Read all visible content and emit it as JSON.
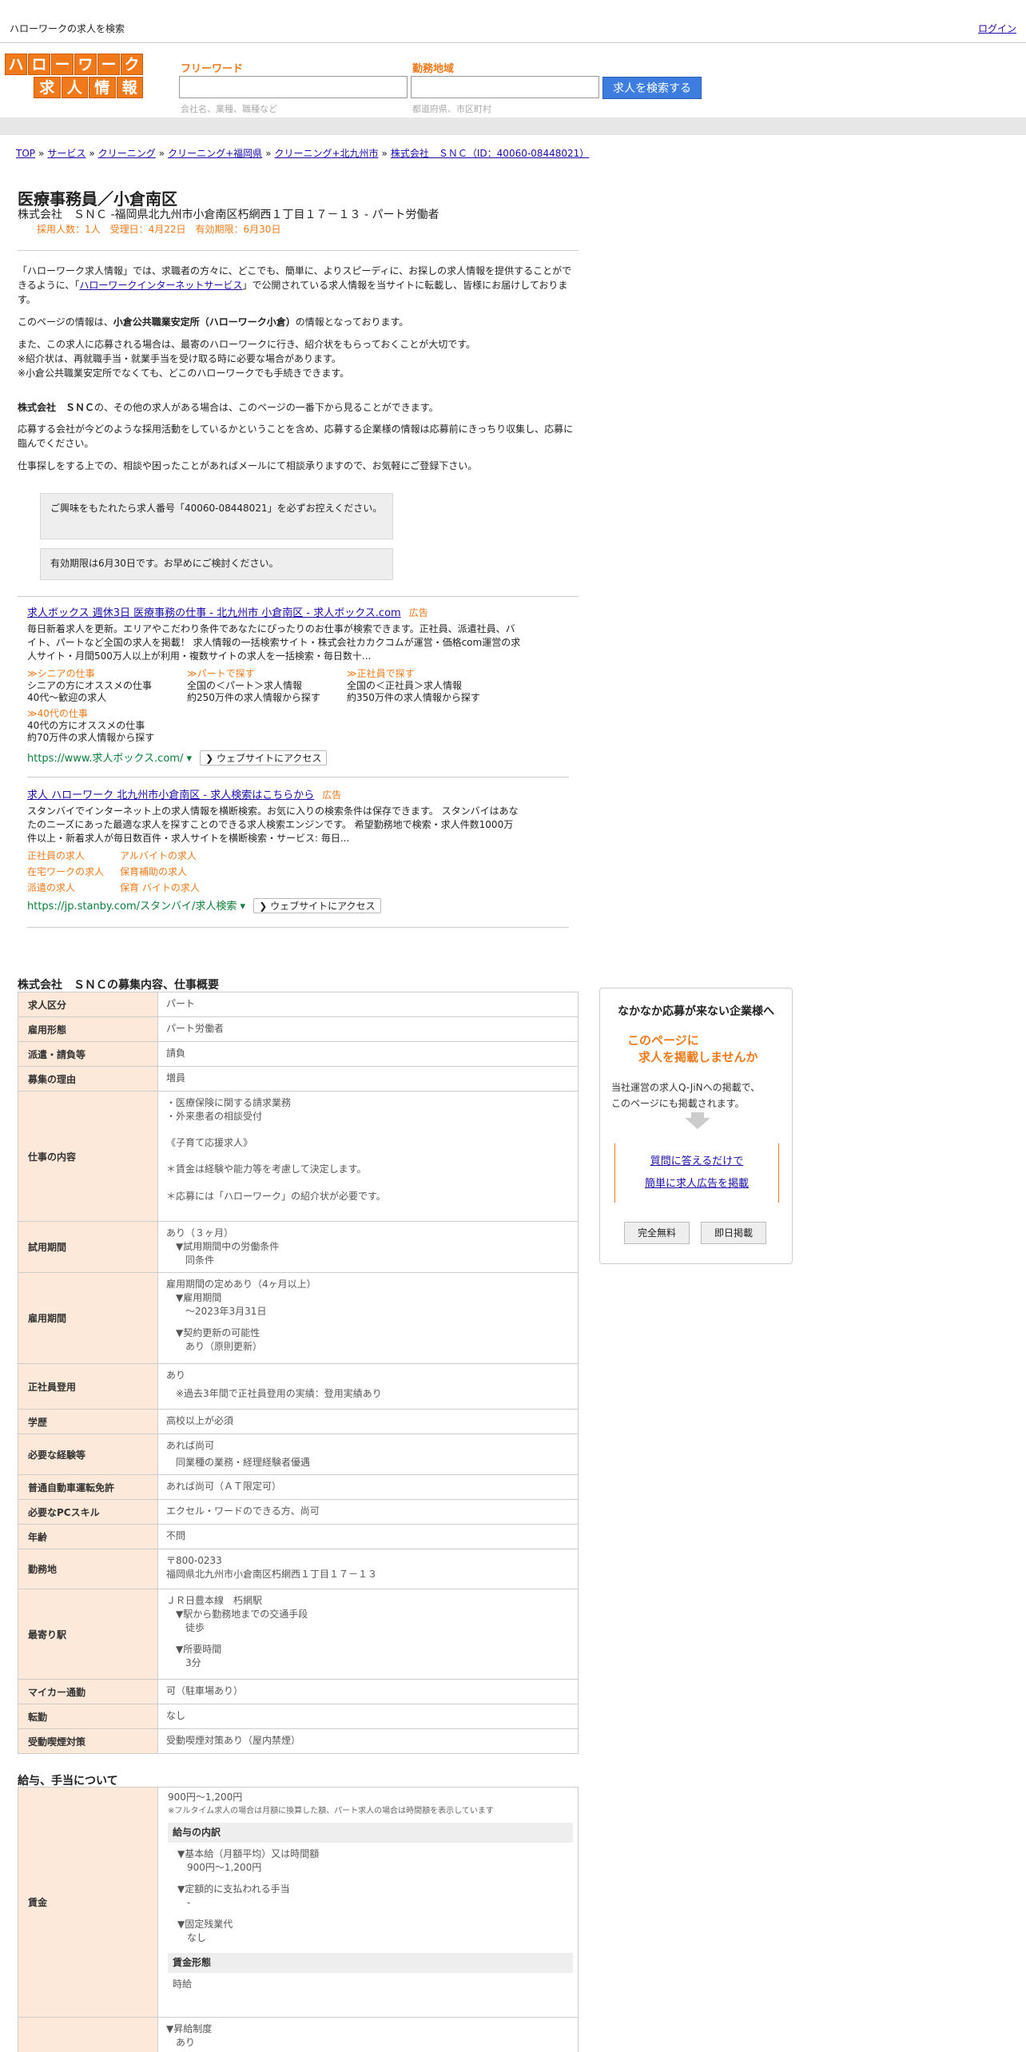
{
  "topbar": {
    "title": "ハローワークの求人を検索",
    "login": "ログイン"
  },
  "header": {
    "logo_top": [
      "ハ",
      "ロ",
      "ー",
      "ワ",
      "ー",
      "ク"
    ],
    "logo_bottom": [
      "求",
      "人",
      "情",
      "報"
    ],
    "freeword_label": "フリーワード",
    "freeword_hint": "会社名、業種、職種など",
    "area_label": "勤務地域",
    "area_hint": "都道府県、市区町村",
    "search_button": "求人を検索する"
  },
  "breadcrumb": [
    "TOP",
    "サービス",
    "クリーニング",
    "クリーニング+福岡県",
    "クリーニング+北九州市",
    "株式会社　ＳＮＣ（ID：40060-08448021）"
  ],
  "job": {
    "title": "医療事務員／小倉南区",
    "subtitle": "株式会社　ＳＮＣ -福岡県北九州市小倉南区朽網西１丁目１７－１３ - パート労働者",
    "meta": "採用人数：1人　受理日：4月22日　有効期限：6月30日"
  },
  "intro": {
    "p1a": "「ハローワーク求人情報」では、求職者の方々に、どこでも、簡単に、よりスピーディに、お探しの求人情報を提供することができるように、「",
    "p1link": "ハローワークインターネットサービス",
    "p1b": "」で公開されている求人情報を当サイトに転載し、皆様にお届けしております。",
    "p2a": "このページの情報は、",
    "p2b": "小倉公共職業安定所（ハローワーク小倉）",
    "p2c": "の情報となっております。",
    "p3l1": "また、この求人に応募される場合は、最寄のハローワークに行き、紹介状をもらっておくことが大切です。",
    "p3l2": "※紹介状は、再就職手当・就業手当を受け取る時に必要な場合があります。",
    "p3l3": "※小倉公共職業安定所でなくても、どこのハローワークでも手続きできます。",
    "p4a": "株式会社　ＳＮＣ",
    "p4b": "の、その他の求人がある場合は、このページの一番下から見ることができます。",
    "p5": "応募する会社が今どのような採用活動をしているかということを含め、応募する企業様の情報は応募前にきっちり収集し、応募に臨んでください。",
    "p6": "仕事探しをする上での、相談や困ったことがあればメールにて相談承りますので、お気軽にご登録下さい。"
  },
  "notes": {
    "n1": "ご興味をもたれたら求人番号「40060-08448021」を必ずお控えください。",
    "n2": "有効期限は6月30日です。お早めにご検討ください。"
  },
  "ads": [
    {
      "title": "求人ボックス 週休3日 医療事務の仕事 - 北九州市 小倉南区 - 求人ボックス.com",
      "badge": "広告",
      "desc": "毎日新着求人を更新。エリアやこだわり条件であなたにぴったりのお仕事が検索できます。正社員、派遣社員、バイト、パートなど全国の求人を掲載！ 求人情報の一括検索サイト・株式会社カカクコムが運営・価格com運営の求人サイト・月間500万人以上が利用・複数サイトの求人を一括検索・毎日数十...",
      "sublinks": [
        {
          "label": "≫シニアの仕事",
          "l1": "シニアの方にオススメの仕事",
          "l2": "40代～歓迎の求人"
        },
        {
          "label": "≫パートで探す",
          "l1": "全国の＜パート＞求人情報",
          "l2": "約250万件の求人情報から探す"
        },
        {
          "label": "≫正社員で探す",
          "l1": "全国の＜正社員＞求人情報",
          "l2": "約350万件の求人情報から探す"
        },
        {
          "label": "≫40代の仕事",
          "l1": "40代の方にオススメの仕事",
          "l2": "約70万件の求人情報から探す"
        }
      ],
      "url": "https://www.求人ボックス.com/",
      "visit": "❯ ウェブサイトにアクセス"
    },
    {
      "title": "求人 ハローワーク 北九州市小倉南区 - 求人検索はこちらから",
      "badge": "広告",
      "desc": "スタンバイでインターネット上の求人情報を横断検索。お気に入りの検索条件は保存できます。 スタンバイはあなたのニーズにあった最適な求人を探すことのできる求人検索エンジンです。 希望勤務地で検索・求人件数1000万件以上・新着求人が毎日数百件・求人サイトを横断検索・サービス: 毎日...",
      "sublinks": [
        "正社員の求人",
        "アルバイトの求人",
        "在宅ワークの求人",
        "保育補助の求人",
        "派遣の求人",
        "保育 バイトの求人"
      ],
      "url": "https://jp.stanby.com/スタンバイ/求人検索",
      "visit": "❯ ウェブサイトにアクセス"
    }
  ],
  "section1": "株式会社　ＳＮＣの募集内容、仕事概要",
  "details": {
    "r1": {
      "k": "求人区分",
      "v": "パート"
    },
    "r2": {
      "k": "雇用形態",
      "v": "パート労働者"
    },
    "r3": {
      "k": "派遣・請負等",
      "v": "請負"
    },
    "r4": {
      "k": "募集の理由",
      "v": "増員"
    },
    "r5": {
      "k": "仕事の内容",
      "l1": "・医療保険に関する請求業務",
      "l2": "・外来患者の相談受付",
      "l3": "《子育て応援求人》",
      "l4": "＊賃金は経験や能力等を考慮して決定します。",
      "l5": "＊応募には「ハローワーク」の紹介状が必要です。"
    },
    "r6": {
      "k": "試用期間",
      "l1": "あり（３ヶ月）",
      "l2": "▼試用期間中の労働条件",
      "l3": "同条件"
    },
    "r7": {
      "k": "雇用期間",
      "l1": "雇用期間の定めあり（4ヶ月以上）",
      "l2": "▼雇用期間",
      "l3": "〜2023年3月31日",
      "l4": "▼契約更新の可能性",
      "l5": "あり（原則更新）"
    },
    "r8": {
      "k": "正社員登用",
      "l1": "あり",
      "l2": "※過去3年間で正社員登用の実績：登用実績あり"
    },
    "r9": {
      "k": "学歴",
      "v": "高校以上が必須"
    },
    "r10": {
      "k": "必要な経験等",
      "l1": "あれば尚可",
      "l2": "同業種の業務・経理経験者優遇"
    },
    "r11": {
      "k": "普通自動車運転免許",
      "v": "あれば尚可（ＡＴ限定可）"
    },
    "r12": {
      "k": "必要なPCスキル",
      "v": "エクセル・ワードのできる方、尚可"
    },
    "r13": {
      "k": "年齢",
      "v": "不問"
    },
    "r14": {
      "k": "勤務地",
      "l1": "〒800-0233",
      "l2": "福岡県北九州市小倉南区朽網西１丁目１７－１３"
    },
    "r15": {
      "k": "最寄り駅",
      "l1": "ＪＲ日豊本線　朽網駅",
      "l2": "▼駅から勤務地までの交通手段",
      "l3": "徒歩",
      "l4": "▼所要時間",
      "l5": "3分"
    },
    "r16": {
      "k": "マイカー通勤",
      "v": "可（駐車場あり）"
    },
    "r17": {
      "k": "転勤",
      "v": "なし"
    },
    "r18": {
      "k": "受動喫煙対策",
      "v": "受動喫煙対策あり（屋内禁煙）"
    }
  },
  "section2": "給与、手当について",
  "pay": {
    "k": "賃金",
    "l1": "900円〜1,200円",
    "note": "※フルタイム求人の場合は月額に換算した額、パート求人の場合は時間額を表示しています",
    "h1": "給与の内訳",
    "b1": "▼基本給（月額平均）又は時間額",
    "b1v": "900円〜1,200円",
    "b2": "▼定額的に支払われる手当",
    "b2v": "-",
    "b3": "▼固定残業代",
    "b3v": "なし",
    "h2": "賃金形態",
    "h2v": "時給",
    "next1": "▼昇給制度",
    "next2": "あり"
  },
  "side": {
    "heading": "なかなか応募が来ない企業様へ",
    "orange1": "このページに",
    "orange2": "求人を掲載しませんか",
    "p1": "当社運営の求人Q-JiNへの掲載で、",
    "p2": "このページにも掲載されます。",
    "cta1": "質問に答えるだけで",
    "cta2": "簡単に求人広告を掲載",
    "btn1": "完全無料",
    "btn2": "即日掲載"
  },
  "colors": {
    "accent": "#f07a1a",
    "link": "#1a0dab",
    "button": "#3d7de0",
    "th_bg": "#fde9d9",
    "url_green": "#0a7f3a"
  }
}
